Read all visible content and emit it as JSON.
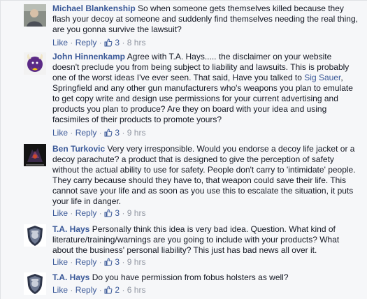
{
  "comments": [
    {
      "author": "Michael Blankenship",
      "text": "So when someone gets themselves killed because they flash your decoy at someone and suddenly find themselves needing the real thing, are you gonna survive the lawsuit?",
      "like_label": "Like",
      "reply_label": "Reply",
      "likes": "3",
      "time": "8 hrs",
      "avatar_icon": "profile-photo-icon"
    },
    {
      "author": "John Hinnenkamp",
      "text_before_link": "Agree with T.A. Hays..... the disclaimer on your website doesn't preclude you from being subject to liability and lawsuits. This is probably one of the worst ideas I've ever seen. That said, Have you talked to ",
      "link_text": "Sig Sauer",
      "text_after_link": ", Springfield and any other gun manufacturers who's weapons you plan to emulate to get copy write and design use permissions for your current advertising and products you plan to produce? Are they on board with your idea and using facsimiles of their products to promote yours?",
      "like_label": "Like",
      "reply_label": "Reply",
      "likes": "3",
      "time": "9 hrs",
      "avatar_icon": "vikings-logo-icon"
    },
    {
      "author": "Ben Turkovic",
      "text": "Very very irresponsible. Would you endorse a decoy life jacket or a decoy parachute? a product that is designed to give the perception of safety without the actual ability to use for safety. People don't carry to 'intimidate' people. They carry because should they have to, that weapon could save their life. This cannot save your life and as soon as you use this to escalate the situation, it puts your life in danger.",
      "like_label": "Like",
      "reply_label": "Reply",
      "likes": "3",
      "time": "9 hrs",
      "avatar_icon": "game-character-icon"
    },
    {
      "author": "T.A. Hays",
      "text": "Personally think this idea is very bad idea. Question. What kind of literature/training/warnings are you going to include with your products? What about the business' personal liability? This just has bad news all over it.",
      "like_label": "Like",
      "reply_label": "Reply",
      "likes": "3",
      "time": "9 hrs",
      "avatar_icon": "police-badge-icon"
    },
    {
      "author": "T.A. Hays",
      "text": "Do you have permission from fobus holsters as well?",
      "like_label": "Like",
      "reply_label": "Reply",
      "likes": "2",
      "time": "6 hrs",
      "avatar_icon": "police-badge-icon"
    }
  ],
  "colors": {
    "link": "#3b5998",
    "meta": "#9197a3",
    "text": "#141823",
    "background": "#f6f7f9"
  }
}
